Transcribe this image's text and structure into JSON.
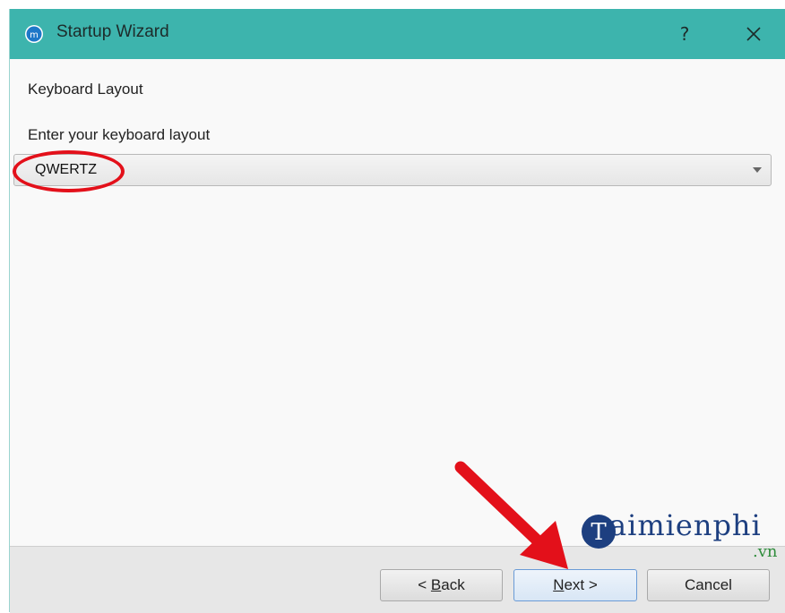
{
  "window": {
    "title": "Startup Wizard",
    "help_glyph": "?",
    "titlebar_color": "#3db4ad"
  },
  "page": {
    "heading": "Keyboard Layout",
    "field_label": "Enter your keyboard layout",
    "combo_value": "QWERTZ"
  },
  "footer": {
    "back": {
      "prefix": "< ",
      "mnemonic": "B",
      "rest": "ack"
    },
    "next": {
      "mnemonic": "N",
      "rest": "ext >"
    },
    "cancel": "Cancel"
  },
  "annotations": {
    "highlight_color": "#e3101a"
  },
  "watermark": {
    "brand": "aimienphi",
    "suffix": ".vn",
    "logo_letter": "T"
  },
  "icons": {
    "app": "app-logo-icon",
    "close": "close-icon",
    "dropdown": "chevron-down-icon"
  }
}
